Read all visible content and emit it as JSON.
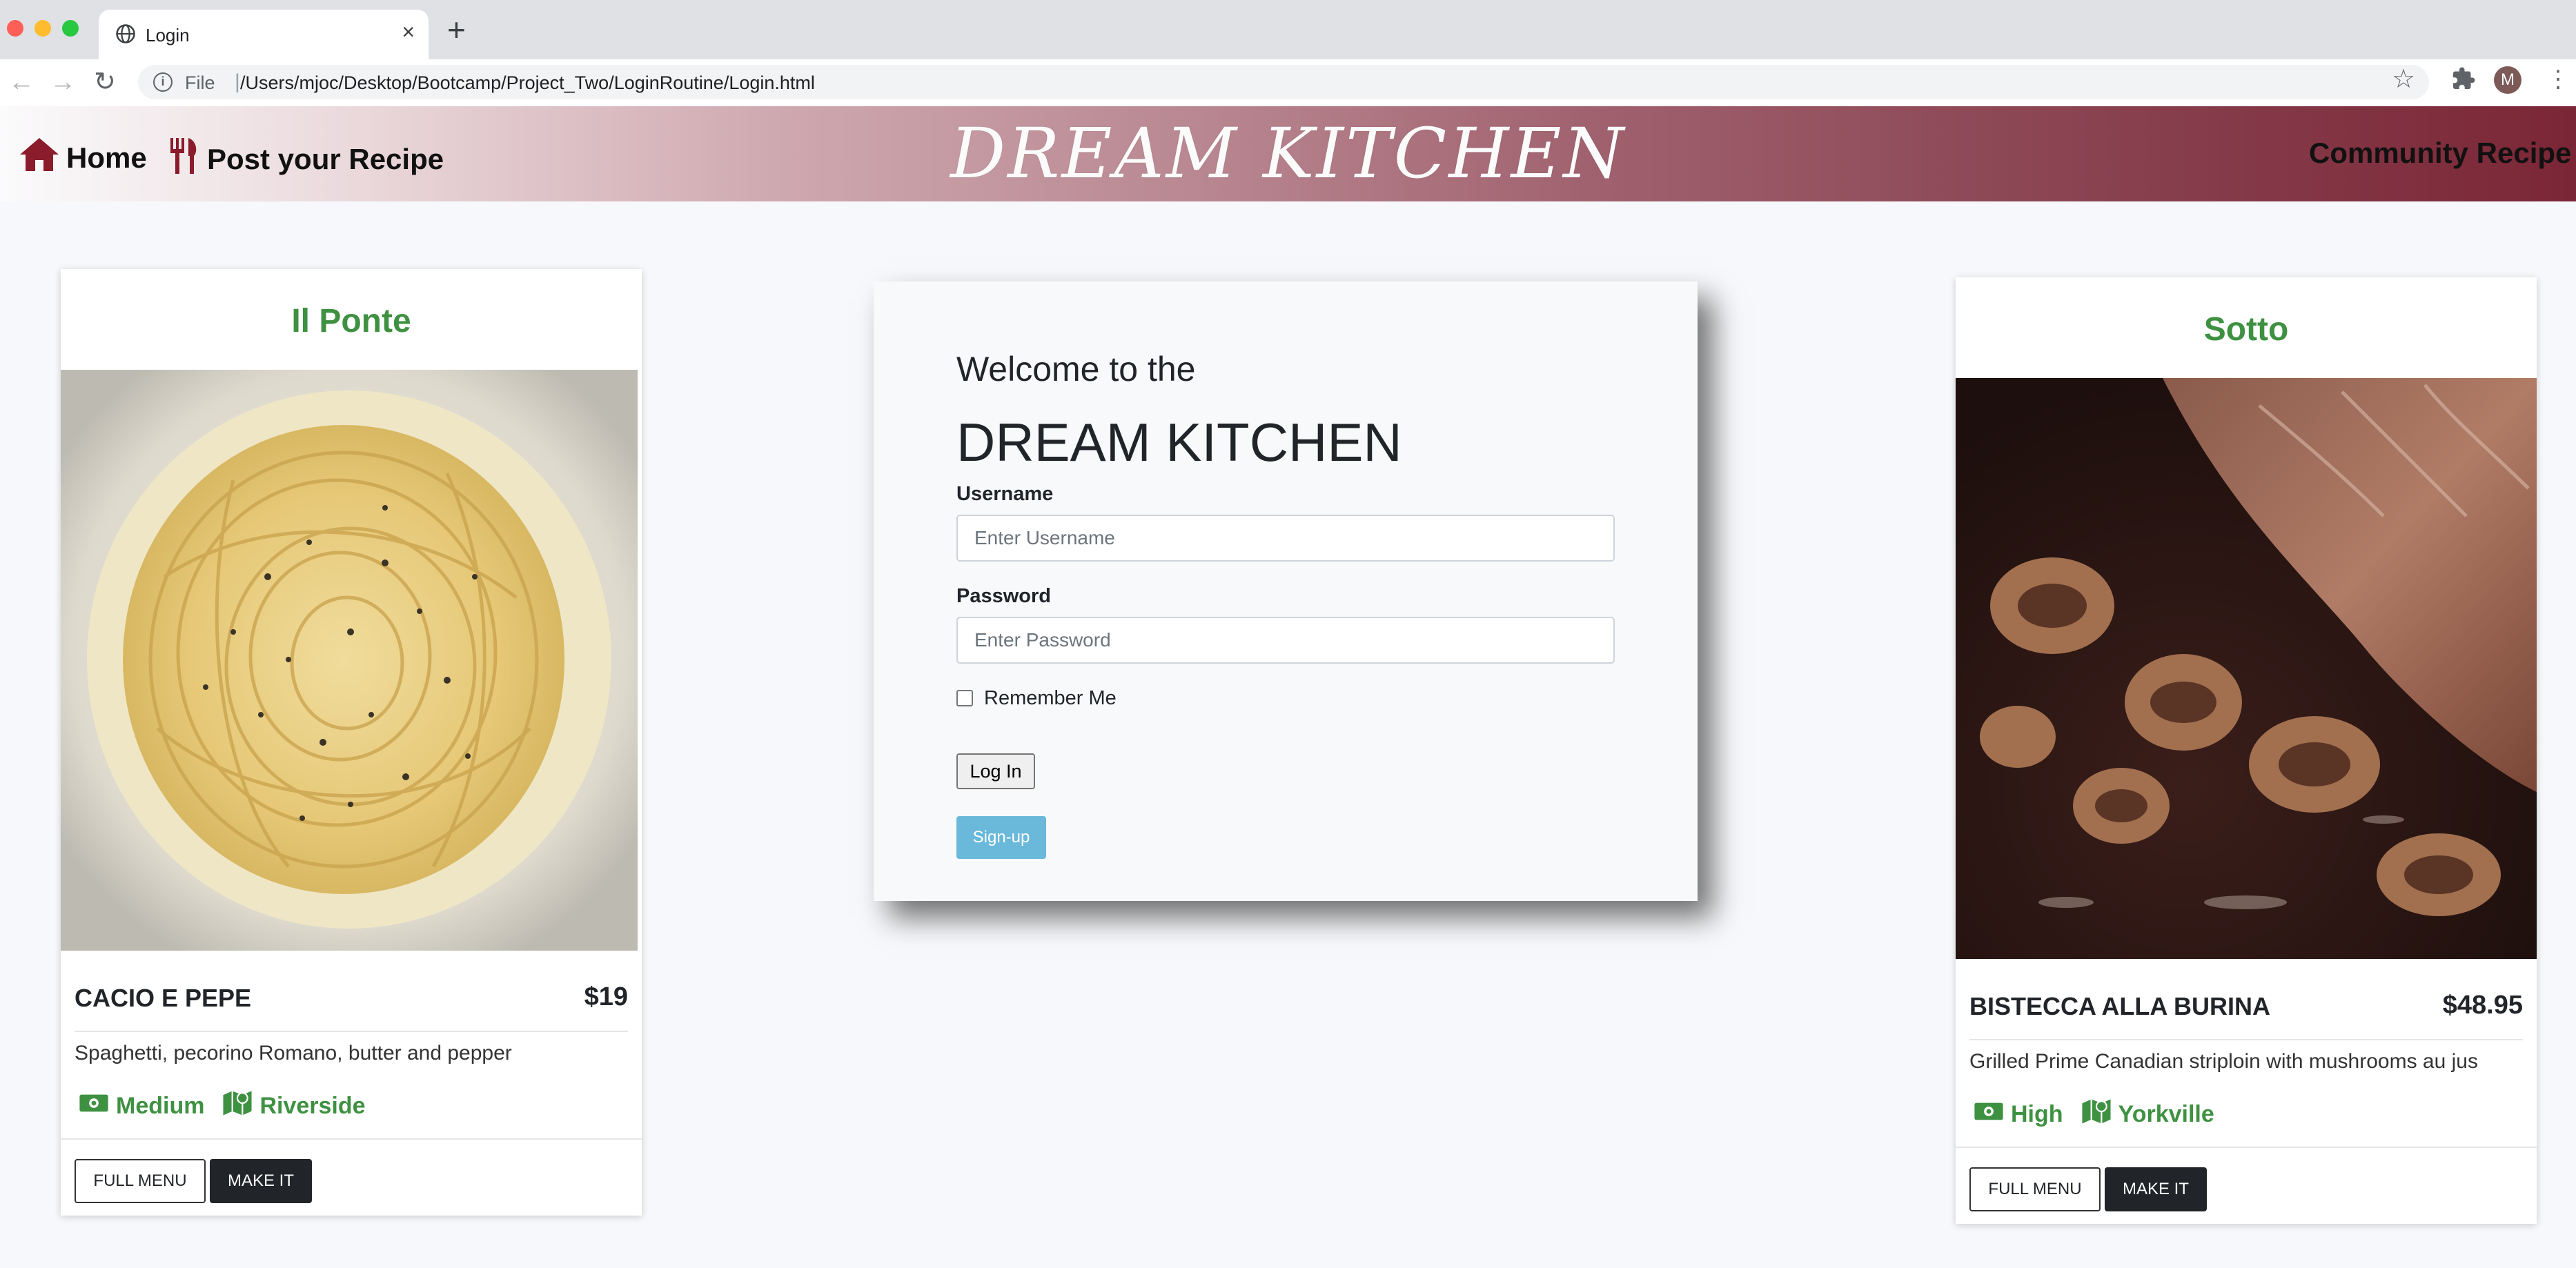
{
  "browser": {
    "tab_title": "Login",
    "url_scheme_label": "File",
    "url_separator": "|",
    "url": "/Users/mjoc/Desktop/Bootcamp/Project_Two/LoginRoutine/Login.html",
    "avatar_letter": "M",
    "traffic_colors": [
      "#ff5f57",
      "#febc2e",
      "#28c840"
    ]
  },
  "nav": {
    "home": "Home",
    "post": "Post your Recipe",
    "brand": "DREAM KITCHEN",
    "community": "Community Recipe"
  },
  "login": {
    "welcome": "Welcome to the",
    "brand": "DREAM KITCHEN",
    "username_label": "Username",
    "username_placeholder": "Enter Username",
    "password_label": "Password",
    "password_placeholder": "Enter Password",
    "remember": "Remember Me",
    "login_button": "Log In",
    "signup_button": "Sign-up"
  },
  "cards": [
    {
      "restaurant": "Il Ponte",
      "dish": "CACIO E PEPE",
      "price": "$19",
      "description": "Spaghetti, pecorino Romano, butter and pepper",
      "price_level": "Medium",
      "area": "Riverside",
      "full_menu": "FULL MENU",
      "make_it": "MAKE IT"
    },
    {
      "restaurant": "Sotto",
      "dish": "BISTECCA ALLA BURINA",
      "price": "$48.95",
      "description": "Grilled Prime Canadian striploin with mushrooms au jus",
      "price_level": "High",
      "area": "Yorkville",
      "full_menu": "FULL MENU",
      "make_it": "MAKE IT"
    }
  ],
  "colors": {
    "accent_green": "#3f9142",
    "nav_gradient_end": "#7b2636",
    "signup_blue": "#6ab8da"
  }
}
